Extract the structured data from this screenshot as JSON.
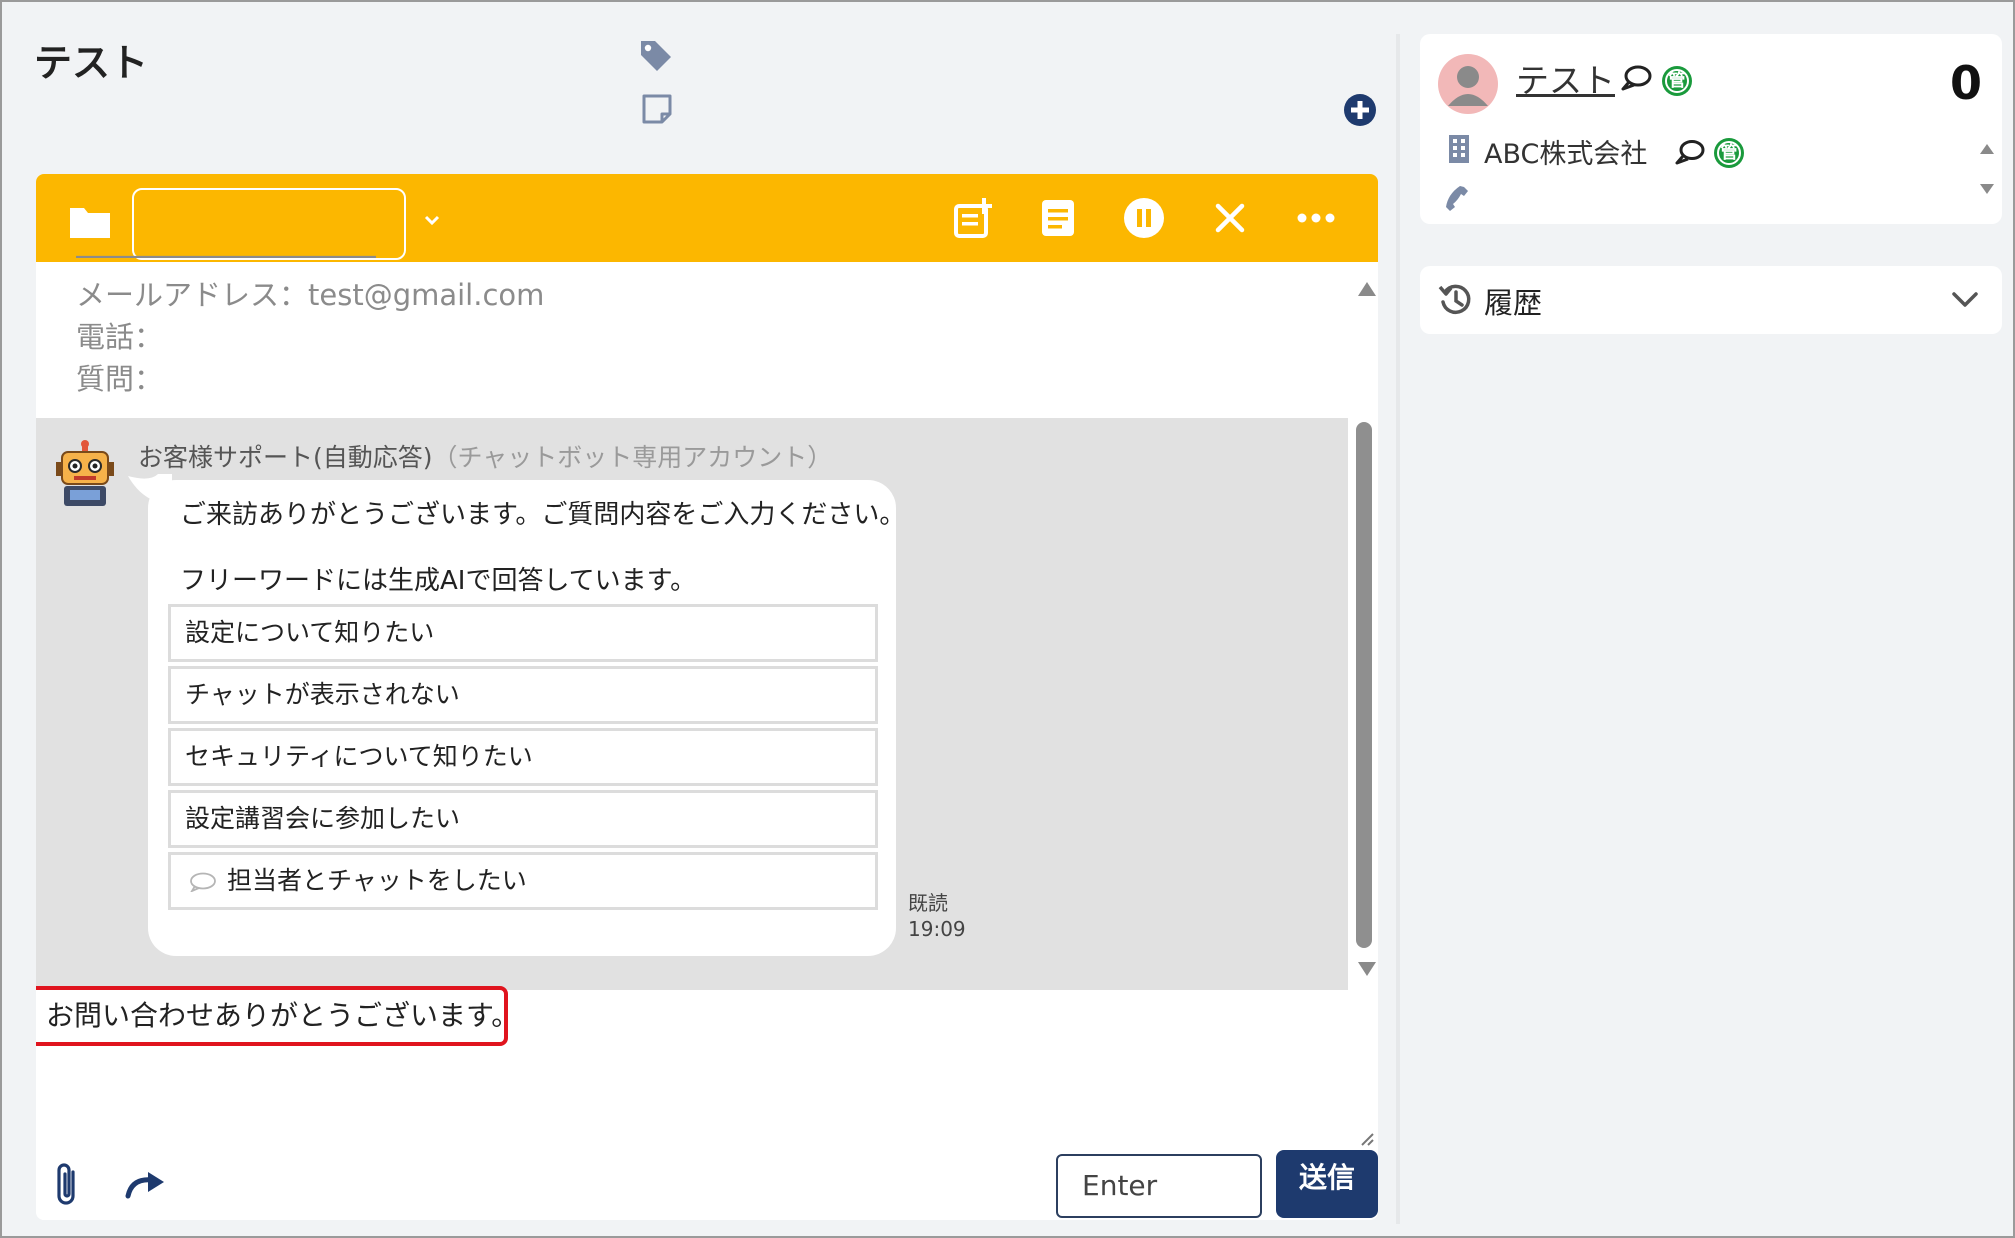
{
  "header": {
    "title": "テスト"
  },
  "toolbar": {
    "select_value": ""
  },
  "info": {
    "email": "メールアドレス：test@gmail.com",
    "phone": "電話：",
    "question": "質問："
  },
  "message": {
    "sender": "お客様サポート(自動応答)",
    "account": "（チャットボット専用アカウント）",
    "line1": "ご来訪ありがとうございます。ご質問内容をご入力ください。",
    "line2": "フリーワードには生成AIで回答しています。",
    "options": [
      "設定について知りたい",
      "チャットが表示されない",
      "セキュリティについて知りたい",
      "設定講習会に参加したい",
      "担当者とチャットをしたい"
    ],
    "read_label": "既読",
    "time": "19:09"
  },
  "composer": {
    "text": "お問い合わせありがとうございます。",
    "enter_label": "Enter",
    "send_label": "送信"
  },
  "contact": {
    "name": "テスト",
    "badge": "管",
    "count": "0",
    "company": "ABC株式会社"
  },
  "history": {
    "label": "履歴"
  },
  "colors": {
    "toolbar": "#fcb700",
    "send_button": "#1e3a6e",
    "highlight_border": "#e0141e",
    "badge_green": "#1a9a3c"
  }
}
